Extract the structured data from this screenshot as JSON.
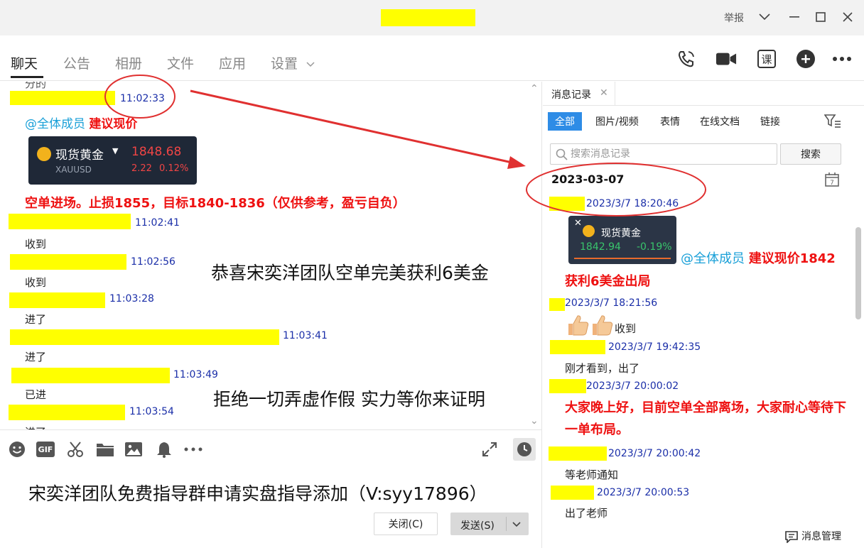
{
  "window": {
    "report_label": "举报",
    "icons": [
      "chevron-down-icon",
      "minimize-icon",
      "maximize-icon",
      "close-icon"
    ]
  },
  "tabs": [
    {
      "label": "聊天",
      "active": true
    },
    {
      "label": "公告"
    },
    {
      "label": "相册"
    },
    {
      "label": "文件"
    },
    {
      "label": "应用"
    },
    {
      "label": "设置"
    }
  ],
  "top_icons": [
    "phone-icon",
    "video-icon",
    "class-icon",
    "add-icon",
    "more-icon"
  ],
  "top_icon_labels": {
    "class": "课"
  },
  "chat": {
    "partial_top": "分的",
    "msgs": [
      {
        "ts": "11:02:33",
        "mention": "@全体成员",
        "red": "建议现价"
      },
      {
        "card": {
          "name": "现货黄金",
          "symbol": "XAUUSD",
          "price": "1848.68",
          "change": "2.22",
          "pct": "0.12%"
        }
      },
      {
        "red_line": "空单进场。止损1855，目标1840-1836（仅供参考，盈亏自负）"
      },
      {
        "ts": "11:02:41",
        "text": "收到"
      },
      {
        "ts": "11:02:56",
        "text": "收到"
      },
      {
        "ts": "11:03:28",
        "text": "进了"
      },
      {
        "ts": "11:03:41",
        "text": "进了"
      },
      {
        "ts": "11:03:49",
        "text": "已进"
      },
      {
        "ts": "11:03:54",
        "text": "进了"
      }
    ],
    "overlay_1": "恭喜宋奕洋团队空单完美获利6美金",
    "overlay_2": "拒绝一切弄虚作假 实力等你来证明"
  },
  "input": {
    "tool_icons": [
      "emoji-icon",
      "gif-icon",
      "scissors-icon",
      "folder-icon",
      "image-icon",
      "bell-icon",
      "more-icon",
      "expand-icon",
      "history-clock-icon"
    ],
    "gif_label": "GIF",
    "text": "宋奕洋团队免费指导群申请实盘指导添加（V:syy17896）",
    "close_label": "关闭(C)",
    "send_label": "发送(S)"
  },
  "history": {
    "tab_label": "消息记录",
    "filters": [
      "全部",
      "图片/视频",
      "表情",
      "在线文档",
      "链接"
    ],
    "search_placeholder": "搜索消息记录",
    "search_button": "搜索",
    "date": "2023-03-07",
    "items": [
      {
        "ts": "2023/3/7 18:20:46"
      },
      {
        "card": {
          "name": "现货黄金",
          "price": "1842.94",
          "pct": "-0.19%"
        },
        "mention": "@全体成员",
        "red": "建议现价1842",
        "red2": "获利6美金出局"
      },
      {
        "ts": "2023/3/7 18:21:56",
        "text": "收到",
        "emoji": "thumbs-up-icon"
      },
      {
        "ts": "2023/3/7 19:42:35",
        "text": "刚才看到，出了"
      },
      {
        "ts": "2023/3/7 20:00:02",
        "red": "大家晚上好，目前空单全部离场，大家耐心等待下一单布局。"
      },
      {
        "ts": "2023/3/7 20:00:42",
        "text": "等老师通知"
      },
      {
        "ts": "2023/3/7 20:00:53",
        "text": "出了老师"
      }
    ],
    "manage_label": "消息管理"
  },
  "colors": {
    "highlight": "#ffff00",
    "timestamp": "#1a2ea8",
    "mention": "#1aa0d8",
    "red": "#ee1111",
    "accent": "#2e8ce6",
    "annotation": "#e03030"
  }
}
